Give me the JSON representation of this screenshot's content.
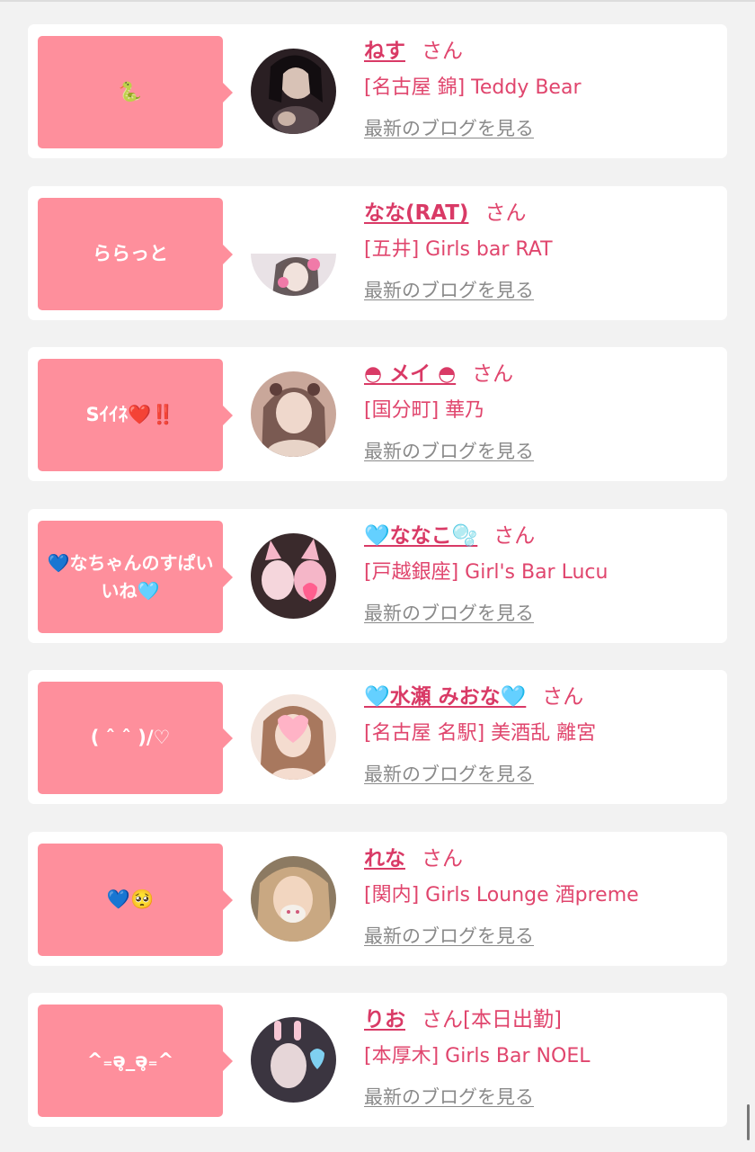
{
  "theme": {
    "accent_pink": "#fe8f9c",
    "name_color": "#d93a66",
    "link_gray": "#8a8a8a",
    "background": "#f2f2f2"
  },
  "blog_link_label": "最新のブログを見る",
  "san_label": "さん",
  "cards": [
    {
      "comment": "🐍",
      "name": "ねす",
      "extra": "",
      "shop": "[名古屋 錦] Teddy Bear",
      "avatar_colors": [
        "#2a1f23",
        "#5a4a4e",
        "#c9b2a6"
      ]
    },
    {
      "comment": "ららっと",
      "name": "なな(RAT)",
      "extra": "",
      "shop": "[五井] Girls bar RAT",
      "avatar_colors": [
        "#ffffff",
        "#d8d0d4",
        "#f07aa8"
      ]
    },
    {
      "comment": "Sｲｲﾈ❤️‼️",
      "name": "◓ メイ ◓",
      "extra": "",
      "shop": "[国分町] 華乃",
      "avatar_colors": [
        "#c9a79a",
        "#e8d4c8",
        "#7a5a52"
      ]
    },
    {
      "comment": "💙なちゃんのすぱいいね🩵",
      "name": "🩵ななこ🫧",
      "extra": "",
      "shop": "[戸越銀座] Girl's Bar Lucu",
      "avatar_colors": [
        "#3a2a2c",
        "#f5b6c8",
        "#ff5f8f"
      ]
    },
    {
      "comment": "( ˆ ˆ )/♡",
      "name": "🩵水瀬 みおな🩵",
      "extra": "",
      "shop": "[名古屋 名駅] 美酒乱 離宮",
      "avatar_colors": [
        "#f3e4dc",
        "#a8785e",
        "#ffb3c6"
      ]
    },
    {
      "comment": "💙🥺",
      "name": "れな",
      "extra": "",
      "shop": "[関内] Girls Lounge 酒preme",
      "avatar_colors": [
        "#8c7a62",
        "#e9c7a8",
        "#f4f0ea"
      ]
    },
    {
      "comment": "^₌ǝ̥_ǝ̥₌^",
      "name": "りお",
      "extra": "[本日出勤]",
      "shop": "[本厚木] Girls Bar NOEL",
      "avatar_colors": [
        "#3b3540",
        "#e6d6d8",
        "#7fd0f0"
      ]
    }
  ]
}
